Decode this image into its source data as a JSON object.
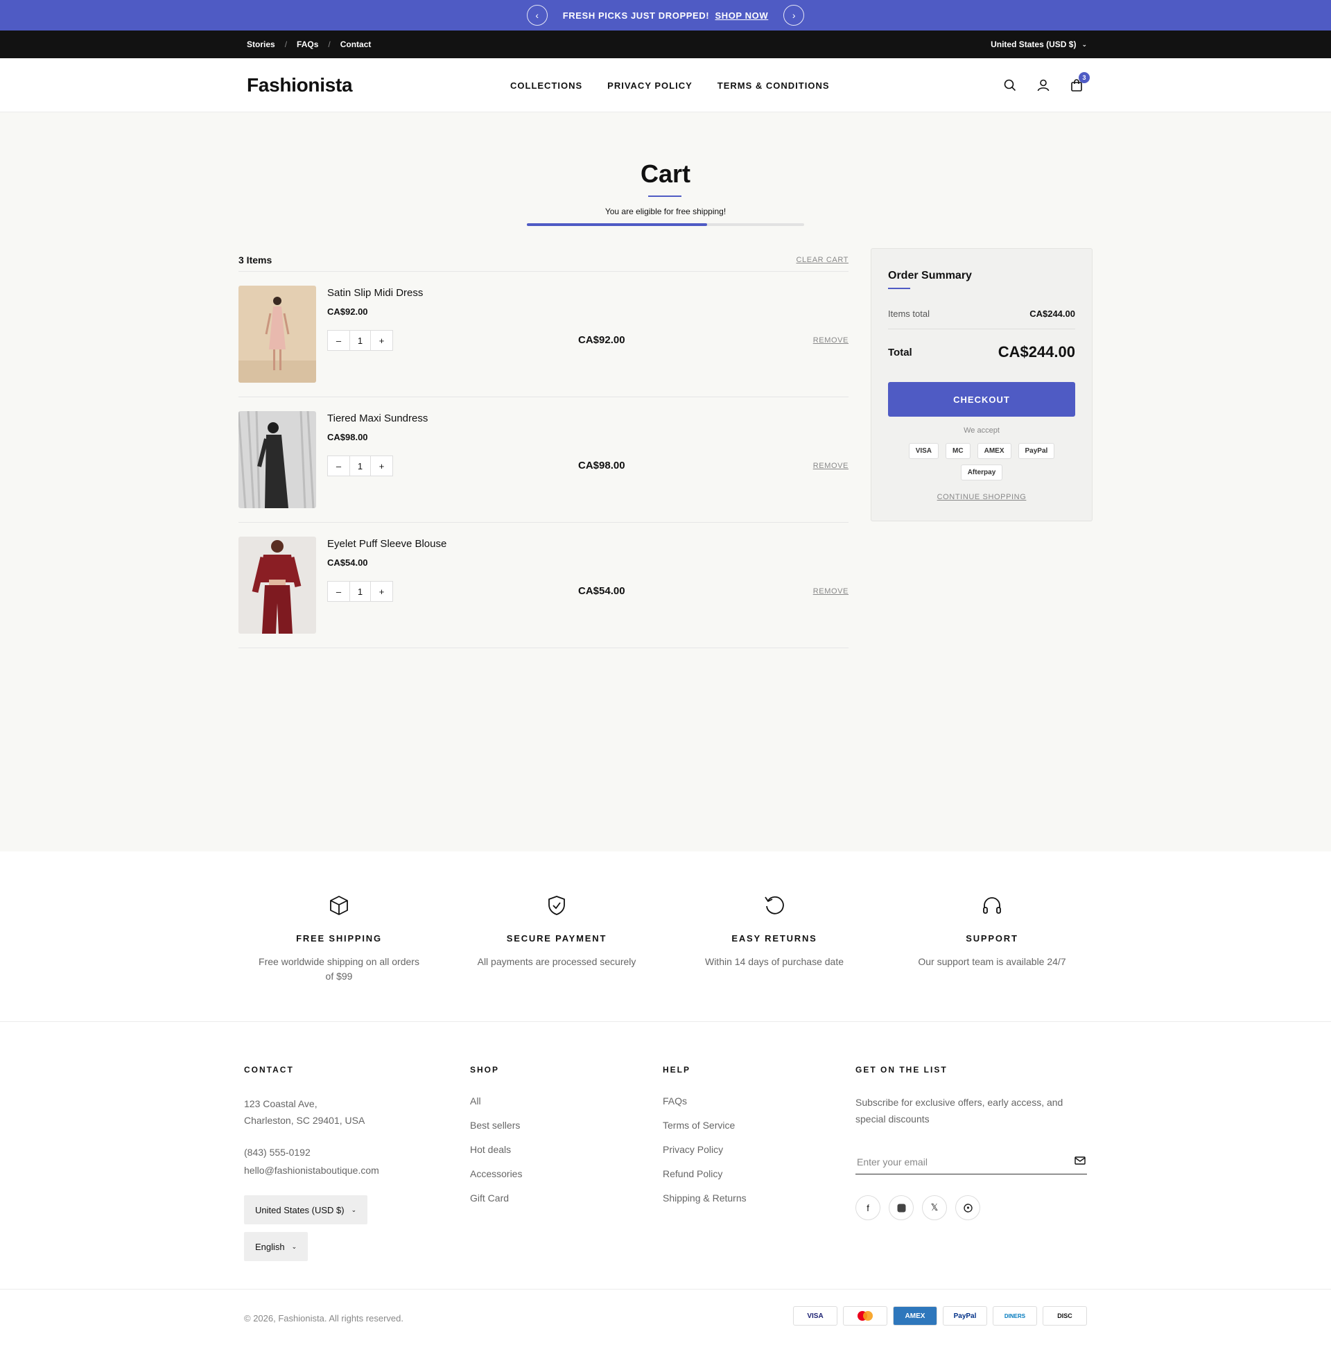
{
  "announcement": {
    "text": "FRESH PICKS JUST DROPPED!",
    "link": "SHOP NOW"
  },
  "utility": {
    "links": [
      "Stories",
      "FAQs",
      "Contact"
    ],
    "country": "United States (USD $)"
  },
  "header": {
    "logo": "Fashionista",
    "nav": [
      "COLLECTIONS",
      "PRIVACY POLICY",
      "TERMS & CONDITIONS"
    ],
    "cart_count": "3"
  },
  "cart": {
    "title": "Cart",
    "shipping_message": "You are eligible for free shipping!",
    "shipping_progress": 0.65,
    "items_count": "3 Items",
    "clear_label": "CLEAR CART",
    "remove_label": "REMOVE",
    "items": [
      {
        "name": "Satin Slip Midi Dress",
        "price": "CA$92.00",
        "qty": "1",
        "total": "CA$92.00"
      },
      {
        "name": "Tiered Maxi Sundress",
        "price": "CA$98.00",
        "qty": "1",
        "total": "CA$98.00"
      },
      {
        "name": "Eyelet Puff Sleeve Blouse",
        "price": "CA$54.00",
        "qty": "1",
        "total": "CA$54.00"
      }
    ]
  },
  "summary": {
    "title": "Order Summary",
    "items_total_label": "Items total",
    "items_total": "CA$244.00",
    "total_label": "Total",
    "total": "CA$244.00",
    "checkout": "CHECKOUT",
    "we_accept": "We accept",
    "methods": [
      "VISA",
      "MC",
      "AMEX",
      "PayPal",
      "Afterpay"
    ],
    "continue": "CONTINUE SHOPPING"
  },
  "features": [
    {
      "icon": "box-icon",
      "title": "FREE SHIPPING",
      "text": "Free worldwide shipping on all orders of $99"
    },
    {
      "icon": "shield-check-icon",
      "title": "SECURE PAYMENT",
      "text": "All payments are processed securely"
    },
    {
      "icon": "return-icon",
      "title": "EASY RETURNS",
      "text": "Within 14 days of purchase date"
    },
    {
      "icon": "headphones-icon",
      "title": "SUPPORT",
      "text": "Our support team is available 24/7"
    }
  ],
  "footer": {
    "contact": {
      "title": "CONTACT",
      "address1": "123 Coastal Ave,",
      "address2": "Charleston, SC 29401, USA",
      "phone": "(843) 555-0192",
      "email": "hello@fashionistaboutique.com",
      "country": "United States (USD $)",
      "language": "English"
    },
    "shop": {
      "title": "SHOP",
      "links": [
        "All",
        "Best sellers",
        "Hot deals",
        "Accessories",
        "Gift Card"
      ]
    },
    "help": {
      "title": "HELP",
      "links": [
        "FAQs",
        "Terms of Service",
        "Privacy Policy",
        "Refund Policy",
        "Shipping & Returns"
      ]
    },
    "newsletter": {
      "title": "GET ON THE LIST",
      "text": "Subscribe for exclusive offers, early access, and special discounts",
      "placeholder": "Enter your email"
    },
    "copyright": "© 2026, Fashionista. All rights reserved.",
    "payment_badges": [
      "VISA",
      "MC",
      "AMEX",
      "PayPal",
      "DINERS",
      "DISC"
    ]
  },
  "colors": {
    "accent": "#4f5bc4",
    "dark_bar": "#121212",
    "page_bg": "#f8f8f5"
  }
}
